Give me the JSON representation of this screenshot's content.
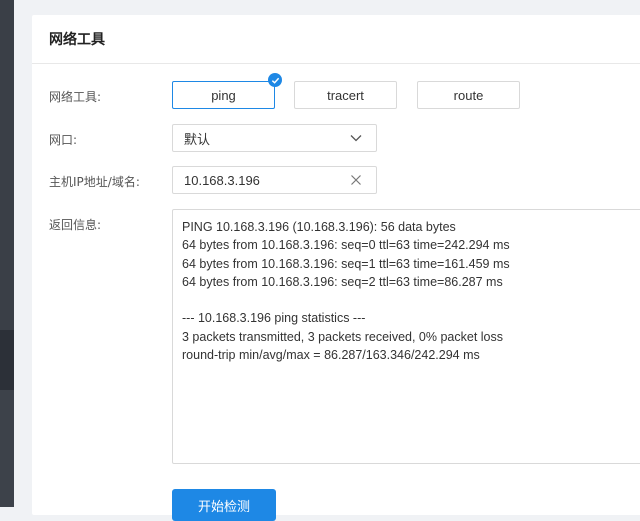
{
  "panel": {
    "title": "网络工具"
  },
  "form": {
    "tool_label": "网络工具:",
    "tools": [
      {
        "label": "ping",
        "selected": true
      },
      {
        "label": "tracert",
        "selected": false
      },
      {
        "label": "route",
        "selected": false
      }
    ],
    "port_label": "网口:",
    "port_value": "默认",
    "host_label": "主机IP地址/域名:",
    "host_value": "10.168.3.196",
    "result_label": "返回信息:",
    "result_lines": [
      "PING 10.168.3.196 (10.168.3.196): 56 data bytes",
      "64 bytes from 10.168.3.196: seq=0 ttl=63 time=242.294 ms",
      "64 bytes from 10.168.3.196: seq=1 ttl=63 time=161.459 ms",
      "64 bytes from 10.168.3.196: seq=2 ttl=63 time=86.287 ms",
      "",
      "--- 10.168.3.196 ping statistics ---",
      "3 packets transmitted, 3 packets received, 0% packet loss",
      "round-trip min/avg/max = 86.287/163.346/242.294 ms"
    ],
    "start_button": "开始检测"
  },
  "colors": {
    "accent": "#1e88e5",
    "border": "#d9d9d9"
  }
}
